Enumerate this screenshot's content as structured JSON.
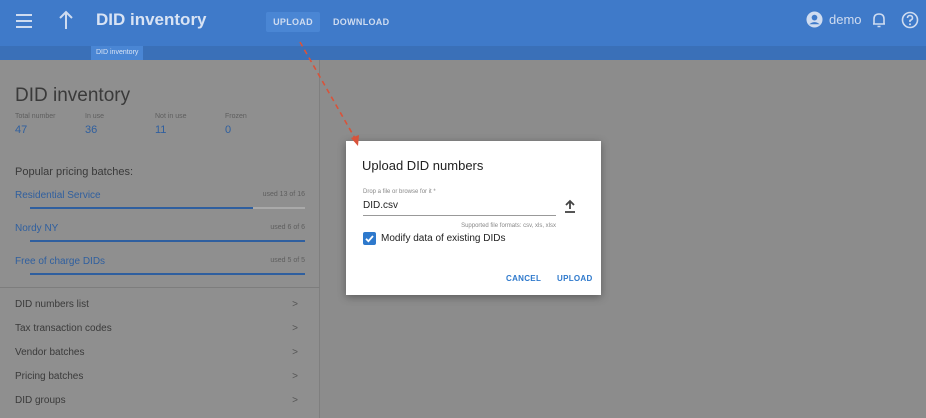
{
  "header": {
    "title": "DID inventory",
    "upload_label": "UPLOAD",
    "download_label": "DOWNLOAD",
    "user": "demo",
    "breadcrumb": "DID inventory"
  },
  "sidebar": {
    "heading": "DID inventory",
    "stats": [
      {
        "label": "Total number",
        "value": "47"
      },
      {
        "label": "In use",
        "value": "36"
      },
      {
        "label": "Not in use",
        "value": "11"
      },
      {
        "label": "Frozen",
        "value": "0"
      }
    ],
    "popular_title": "Popular pricing batches:",
    "batches": [
      {
        "name": "Residential Service",
        "used": "used 13 of 16",
        "progress": 0.8125
      },
      {
        "name": "Nordy NY",
        "used": "used 6 of 6",
        "progress": 1.0
      },
      {
        "name": "Free of charge DIDs",
        "used": "used 5 of 5",
        "progress": 1.0
      }
    ],
    "nav": [
      {
        "label": "DID numbers list",
        "chevron": ">"
      },
      {
        "label": "Tax transaction codes",
        "chevron": ">"
      },
      {
        "label": "Vendor batches",
        "chevron": ">"
      },
      {
        "label": "Pricing batches",
        "chevron": ">"
      },
      {
        "label": "DID groups",
        "chevron": ">"
      }
    ]
  },
  "dialog": {
    "title": "Upload DID numbers",
    "file_label": "Drop a file or browse for it *",
    "file_value": "DID.csv",
    "hint": "Supported file formats: csv, xls, xlsx",
    "checkbox_label": "Modify data of existing DIDs",
    "checkbox_checked": true,
    "cancel_label": "CANCEL",
    "upload_label": "UPLOAD"
  },
  "colors": {
    "accent": "#3f7ac9",
    "link": "#2f5f9f",
    "dialog_button": "#2e79cc",
    "annotation_arrow": "#d9533a"
  },
  "icons": [
    "menu-icon",
    "up-arrow-icon",
    "account-icon",
    "bell-icon",
    "help-icon",
    "upload-icon",
    "checkmark-icon",
    "chevron-right-icon"
  ]
}
